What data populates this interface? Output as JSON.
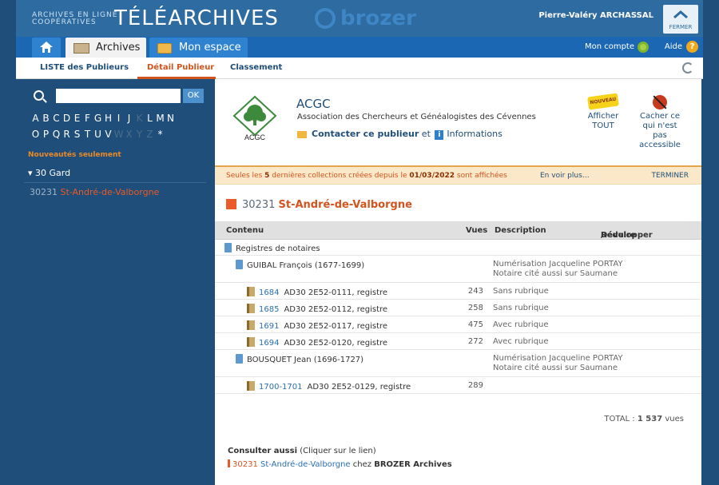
{
  "header": {
    "brand_line1": "ARCHIVES EN LIGNE",
    "brand_line2": "COOPÉRATIVES",
    "brand_title": "TÉLÉARCHIVES",
    "brozer_word": "brozer",
    "user_name": "Pierre-Valéry ARCHASSAL",
    "close_label": "FERMER"
  },
  "nav": {
    "tabs": [
      {
        "label": "Archives"
      },
      {
        "label": "Mon espace"
      }
    ],
    "account_label": "Mon compte",
    "help_label": "Aide",
    "help_glyph": "?"
  },
  "subnav": {
    "items": [
      "LISTE des Publieurs",
      "Détail Publieur",
      "Classement"
    ],
    "active": "Détail Publieur"
  },
  "sidebar": {
    "search_placeholder": "",
    "ok_label": "OK",
    "alpha_row1": [
      "A",
      "B",
      "C",
      "D",
      "E",
      "F",
      "G",
      "H",
      "I",
      "J",
      "K",
      "L",
      "M",
      "N"
    ],
    "alpha_row2": [
      "O",
      "P",
      "Q",
      "R",
      "S",
      "T",
      "U",
      "V",
      "W",
      "X",
      "Y",
      "Z",
      "*"
    ],
    "dim_letters": [
      "K",
      "W",
      "X",
      "Y",
      "Z"
    ],
    "news_label": "Nouveautés seulement",
    "dept_label": "30 Gard",
    "commune_code": "30231",
    "commune_name": "St-André-de-Valborgne"
  },
  "publisher": {
    "logo_text": "ACGC",
    "name": "ACGC",
    "description": "Association des Chercheurs et Généalogistes des Cévennes",
    "contact_label": "Contacter ce publieur",
    "and_label": "et",
    "info_label": "Informations",
    "show_all_badge": "NOUVEAU",
    "show_all_label": "Afficher TOUT",
    "hide_label": "Cacher ce qui n'est pas accessible"
  },
  "notice": {
    "prefix": "Seules les ",
    "count": "5",
    "middle": " dernières collections créées depuis le ",
    "date": "01/03/2022",
    "suffix": " sont affichées",
    "more_label": "En voir plus…",
    "end_label": "TERMINER"
  },
  "selection": {
    "code": "30231",
    "name": "St-André-de-Valborgne"
  },
  "table": {
    "headers": {
      "content": "Contenu",
      "views": "Vues",
      "description": "Description",
      "expand": "Développer",
      "slash": "/",
      "collapse": "Réduire"
    },
    "series_label": "Registres de notaires",
    "notaries": [
      {
        "name": "GUIBAL François (1677-1699)",
        "desc_line1": "Numérisation Jacqueline PORTAY",
        "desc_line2": "Notaire cité aussi sur Saumane",
        "registers": [
          {
            "year": "1684",
            "ref": "AD30 2E52-0111, registre",
            "views": "243",
            "desc": "Sans rubrique"
          },
          {
            "year": "1685",
            "ref": "AD30 2E52-0112, registre",
            "views": "258",
            "desc": "Sans rubrique"
          },
          {
            "year": "1691",
            "ref": "AD30 2E52-0117, registre",
            "views": "475",
            "desc": "Avec rubrique"
          },
          {
            "year": "1694",
            "ref": "AD30 2E52-0120, registre",
            "views": "272",
            "desc": "Avec rubrique"
          }
        ]
      },
      {
        "name": "BOUSQUET Jean (1696-1727)",
        "desc_line1": "Numérisation Jacqueline PORTAY",
        "desc_line2": "Notaire cité aussi sur Saumane",
        "registers": [
          {
            "year": "1700-1701",
            "ref": "AD30 2E52-0129, registre",
            "views": "289",
            "desc": ""
          }
        ]
      }
    ]
  },
  "total": {
    "label": "TOTAL :",
    "value": "1 537",
    "unit": "vues"
  },
  "consult": {
    "title": "Consulter aussi",
    "hint": "(Cliquer sur le lien)",
    "code": "30231",
    "name": "St-André-de-Valborgne",
    "via": "chez",
    "partner": "BROZER Archives"
  }
}
